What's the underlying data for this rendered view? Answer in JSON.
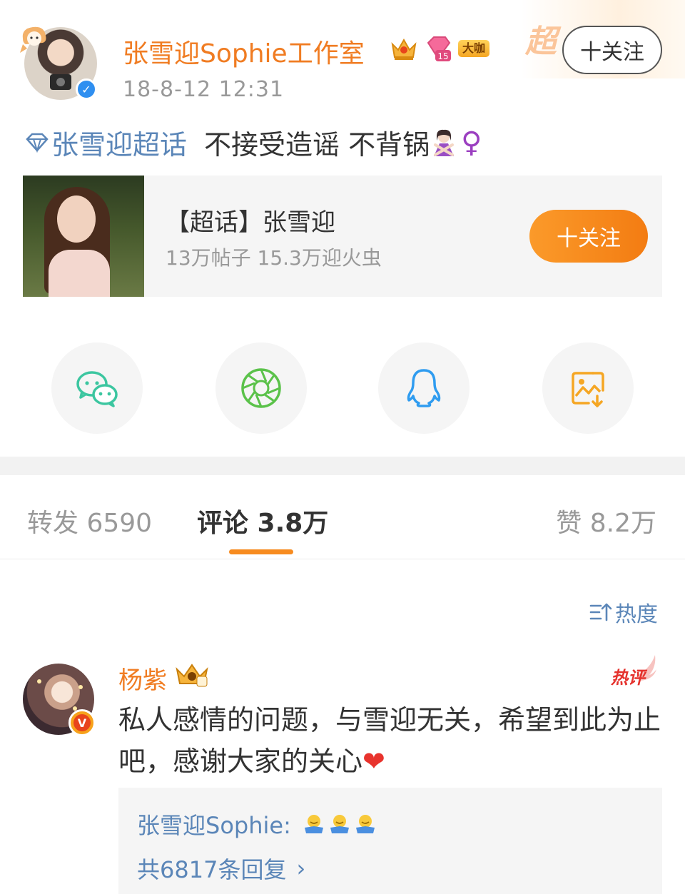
{
  "post": {
    "username": "张雪迎Sophie工作室",
    "timestamp": "18-8-12 12:31",
    "badges": {
      "level_number": "15",
      "daka_label": "大咖"
    },
    "super_label": "超",
    "follow_label": "十关注",
    "topic_link": "张雪迎超话",
    "text": "不接受造谣 不背锅",
    "female_sign": "♀"
  },
  "topic_card": {
    "title": "【超话】张雪迎",
    "stats": "13万帖子 15.3万迎火虫",
    "follow_label": "十关注"
  },
  "share": {
    "items": [
      {
        "name": "wechat",
        "color": "#3cc6a0"
      },
      {
        "name": "moments",
        "color": "#5bc24a"
      },
      {
        "name": "qq",
        "color": "#2f9cf0"
      },
      {
        "name": "save-image",
        "color": "#f5a623"
      }
    ]
  },
  "tabs": {
    "repost": "转发 6590",
    "comments": "评论 3.8万",
    "likes": "赞 8.2万"
  },
  "sort": {
    "label": "热度"
  },
  "comment": {
    "author": "杨紫",
    "hot_label": "热评",
    "text": "私人感情的问题，与雪迎无关，希望到此为止吧，感谢大家的关心",
    "heart": "❤",
    "reply": {
      "author": "张雪迎Sophie:",
      "count_label": "共6817条回复",
      "chevron": "›"
    }
  },
  "colors": {
    "accent_orange": "#f07c22",
    "link_blue": "#5b86b8",
    "verify_blue": "#2f8ff0"
  }
}
